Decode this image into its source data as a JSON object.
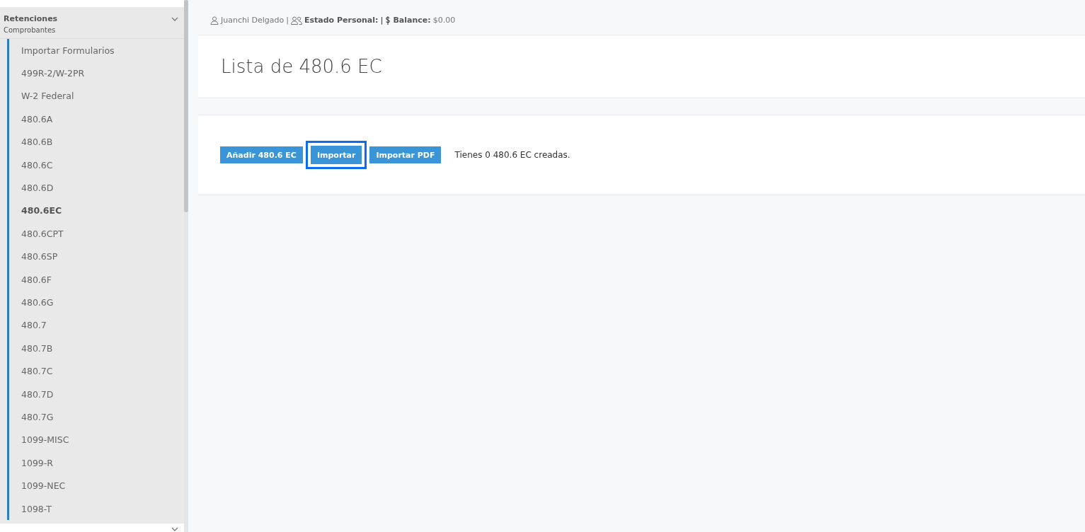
{
  "sidebar": {
    "section": {
      "title": "Retenciones",
      "subtitle": "Comprobantes",
      "expanded": true
    },
    "items": [
      {
        "label": "Importar Formularios",
        "selected": false
      },
      {
        "label": "499R-2/W-2PR",
        "selected": false
      },
      {
        "label": "W-2 Federal",
        "selected": false
      },
      {
        "label": "480.6A",
        "selected": false
      },
      {
        "label": "480.6B",
        "selected": false
      },
      {
        "label": "480.6C",
        "selected": false
      },
      {
        "label": "480.6D",
        "selected": false
      },
      {
        "label": "480.6EC",
        "selected": true
      },
      {
        "label": "480.6CPT",
        "selected": false
      },
      {
        "label": "480.6SP",
        "selected": false
      },
      {
        "label": "480.6F",
        "selected": false
      },
      {
        "label": "480.6G",
        "selected": false
      },
      {
        "label": "480.7",
        "selected": false
      },
      {
        "label": "480.7B",
        "selected": false
      },
      {
        "label": "480.7C",
        "selected": false
      },
      {
        "label": "480.7D",
        "selected": false
      },
      {
        "label": "480.7G",
        "selected": false
      },
      {
        "label": "1099-MISC",
        "selected": false
      },
      {
        "label": "1099-R",
        "selected": false
      },
      {
        "label": "1099-NEC",
        "selected": false
      },
      {
        "label": "1098-T",
        "selected": false
      }
    ]
  },
  "user_bar": {
    "user": "Juanchi Delgado",
    "separator": "|",
    "status_label": "Estado Personal:",
    "separator_2": "|",
    "balance_label": "Balance:",
    "balance": "$0.00"
  },
  "page_title": "Lista de 480.6 EC",
  "buttons": [
    {
      "label": "Añadir 480.6 EC",
      "focused": false
    },
    {
      "label": "Importar",
      "focused": true
    },
    {
      "label": "Importar PDF",
      "focused": false
    }
  ],
  "summary": "Tienes 0 480.6 EC creadas."
}
